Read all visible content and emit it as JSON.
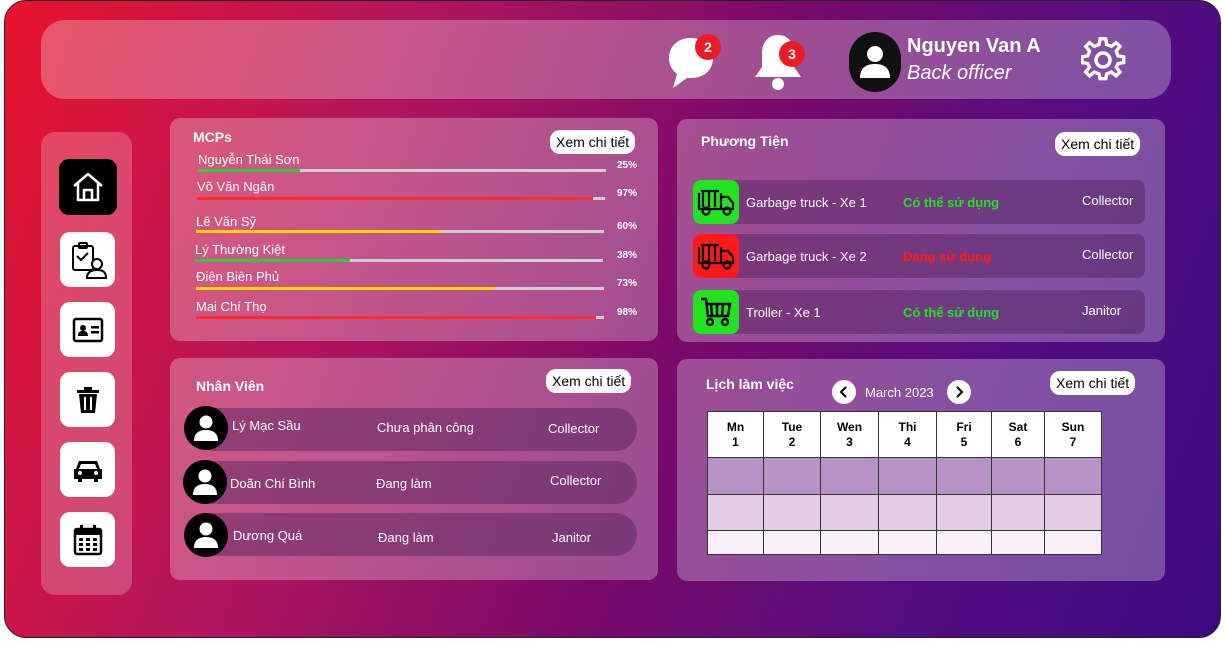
{
  "header": {
    "messages_count": "2",
    "notifications_count": "3",
    "user_name": "Nguyen Van A",
    "user_role": "Back officer"
  },
  "sidebar": {
    "items": [
      {
        "icon": "home-icon"
      },
      {
        "icon": "clipboard-user-icon"
      },
      {
        "icon": "id-card-icon"
      },
      {
        "icon": "trash-icon"
      },
      {
        "icon": "car-icon"
      },
      {
        "icon": "calendar-icon"
      }
    ]
  },
  "mcps": {
    "title": "MCPs",
    "detail_label": "Xem chi tiết",
    "items": [
      {
        "name": "Nguyễn Thái Sơn",
        "percent_label": "25%",
        "percent": 25,
        "color": "#2ecc40"
      },
      {
        "name": "Võ Văn Ngân",
        "percent_label": "97%",
        "percent": 97,
        "color": "#ff2a2a"
      },
      {
        "name": "Lê Văn Sỹ",
        "percent_label": "60%",
        "percent": 60,
        "color": "#ffd700"
      },
      {
        "name": "Lý Thường Kiệt",
        "percent_label": "38%",
        "percent": 38,
        "color": "#2ecc40"
      },
      {
        "name": "Điện Biên Phủ",
        "percent_label": "73%",
        "percent": 73,
        "color": "#ffd700"
      },
      {
        "name": "Mai Chí Thọ",
        "percent_label": "98%",
        "percent": 98,
        "color": "#ff2a2a"
      }
    ]
  },
  "vehicles": {
    "title": "Phương Tiện",
    "detail_label": "Xem chi tiết",
    "items": [
      {
        "name": "Garbage truck - Xe 1",
        "status": "Có thể sử dụng",
        "status_color": "#1fe51f",
        "icon_bg": "#1fe51f",
        "role": "Collector",
        "icon": "truck-icon"
      },
      {
        "name": "Garbage truck - Xe 2",
        "status": "Đang sử dụng",
        "status_color": "#ff1a1a",
        "icon_bg": "#ff1a1a",
        "role": "Collector",
        "icon": "truck-icon"
      },
      {
        "name": "Troller - Xe 1",
        "status": "Có thể sử dụng",
        "status_color": "#1fe51f",
        "icon_bg": "#1fe51f",
        "role": "Janitor",
        "icon": "cart-icon"
      }
    ]
  },
  "staff": {
    "title": "Nhân Viên",
    "detail_label": "Xem chi tiết",
    "items": [
      {
        "name": "Lý Mạc Sầu",
        "status": "Chưa phân công",
        "role": "Collector"
      },
      {
        "name": "Doãn Chí Bình",
        "status": "Đang làm",
        "role": "Collector"
      },
      {
        "name": "Dương Quá",
        "status": "Đang làm",
        "role": "Janitor"
      }
    ]
  },
  "schedule": {
    "title": "Lịch làm việc",
    "month": "March 2023",
    "detail_label": "Xem chi tiết",
    "days": [
      {
        "name": "Mn",
        "date": "1"
      },
      {
        "name": "Tue",
        "date": "2"
      },
      {
        "name": "Wen",
        "date": "3"
      },
      {
        "name": "Thi",
        "date": "4"
      },
      {
        "name": "Fri",
        "date": "5"
      },
      {
        "name": "Sat",
        "date": "6"
      },
      {
        "name": "Sun",
        "date": "7"
      }
    ]
  }
}
